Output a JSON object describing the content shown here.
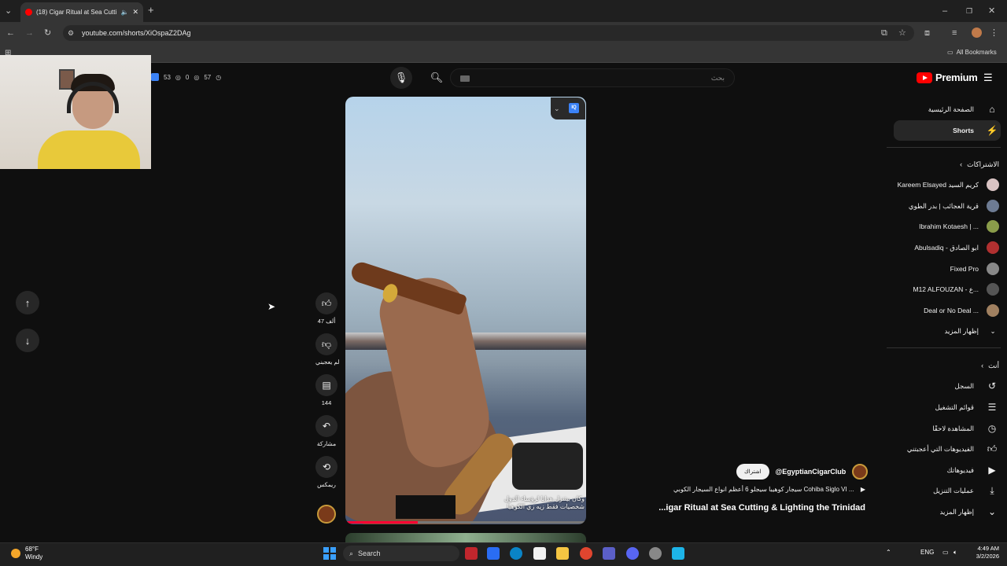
{
  "browser": {
    "tab_title": "(18) Cigar Ritual at Sea Cutti",
    "url": "youtube.com/shorts/XiOspaZ2DAg",
    "bookmarks_label": "All Bookmarks"
  },
  "overlay": {
    "stat1": "53",
    "stat2": "0",
    "stat3": "57"
  },
  "youtube": {
    "logo_text": "Premium",
    "search_placeholder": "بحث",
    "sidebar_main": [
      {
        "label": "الصفحة الرئيسية",
        "icon": "home-icon"
      },
      {
        "label": "Shorts",
        "icon": "shorts-icon"
      }
    ],
    "subscriptions_heading": "الاشتراكات",
    "subscriptions": [
      {
        "label": "Kareem Elsayed كريم السيد",
        "color": "#d9c3c3"
      },
      {
        "label": "قرية العجائب | بدر الطوي",
        "color": "#6d7b93"
      },
      {
        "label": "Ibrahim Kotaesh | ...",
        "color": "#8a9c4a"
      },
      {
        "label": "Abulsadiq - ابو الصادق",
        "color": "#b03030"
      },
      {
        "label": "Fixed Pro",
        "color": "#888888"
      },
      {
        "label": "M12 ALFOUZAN - ع...",
        "color": "#555555"
      },
      {
        "label": "Deal or No Deal ...",
        "color": "#a08060"
      }
    ],
    "show_more_subs": "إظهار المزيد",
    "you_heading": "أنت",
    "you_items": [
      {
        "label": "السجل",
        "icon": "history-icon"
      },
      {
        "label": "قوائم التشغيل",
        "icon": "playlists-icon"
      },
      {
        "label": "المشاهدة لاحقًا",
        "icon": "watch-later-icon"
      },
      {
        "label": "الفيديوهات التي أعجبتني",
        "icon": "liked-icon"
      },
      {
        "label": "فيديوهاتك",
        "icon": "your-videos-icon"
      },
      {
        "label": "عمليات التنزيل",
        "icon": "downloads-icon"
      }
    ],
    "show_more_you": "إظهار المزيد"
  },
  "short": {
    "subtitle_line1": "وكان بيتنزل هدايا لرؤساء الدول",
    "subtitle_line2": "شخصيات فقط زيه زي الكوهيا",
    "likes": "47 ألف",
    "dislike_label": "لم يعجبني",
    "comments": "144",
    "share_label": "مشاركة",
    "remix_label": "ريمكس",
    "subscribe_label": "اشتراك",
    "channel": "@EgyptianCigarClub",
    "description": "سيجار كوهيبا سيجلو 6 أعظم انواع السيجار الكوبي Cohiba Siglo VI ...",
    "title": "...igar Ritual at Sea Cutting & Lighting the Trinidad"
  },
  "taskbar": {
    "weather_temp": "68°F",
    "weather_desc": "Windy",
    "search_label": "Search",
    "lang": "ENG",
    "time": "4:49 AM",
    "date": "3/2/2026"
  }
}
